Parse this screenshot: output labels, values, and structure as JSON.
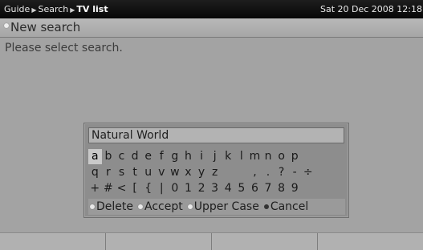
{
  "header": {
    "breadcrumb": [
      "Guide",
      "Search",
      "TV list"
    ],
    "datetime": "Sat 20 Dec 2008 12:18"
  },
  "title": "New search",
  "prompt": "Please select search.",
  "keyboard": {
    "input_value": "Natural World",
    "selected_key": "a",
    "rows": [
      [
        "a",
        "b",
        "c",
        "d",
        "e",
        "f",
        "g",
        "h",
        "i",
        "j",
        "k",
        "l",
        "m",
        "n",
        "o",
        "p"
      ],
      [
        "q",
        "r",
        "s",
        "t",
        "u",
        "v",
        "w",
        "x",
        "y",
        "z",
        " ",
        " ",
        ",",
        ".",
        "?",
        "-",
        "÷"
      ],
      [
        "+",
        "#",
        "<",
        "[",
        "{",
        "|",
        "0",
        "1",
        "2",
        "3",
        "4",
        "5",
        "6",
        "7",
        "8",
        "9"
      ]
    ],
    "legend": {
      "delete": "Delete",
      "accept": "Accept",
      "upper_case": "Upper Case",
      "cancel": "Cancel"
    }
  },
  "colors": {
    "background": "#a3a3a3",
    "header": "#0f0f0f",
    "selected_key": "#c9c9c9"
  }
}
